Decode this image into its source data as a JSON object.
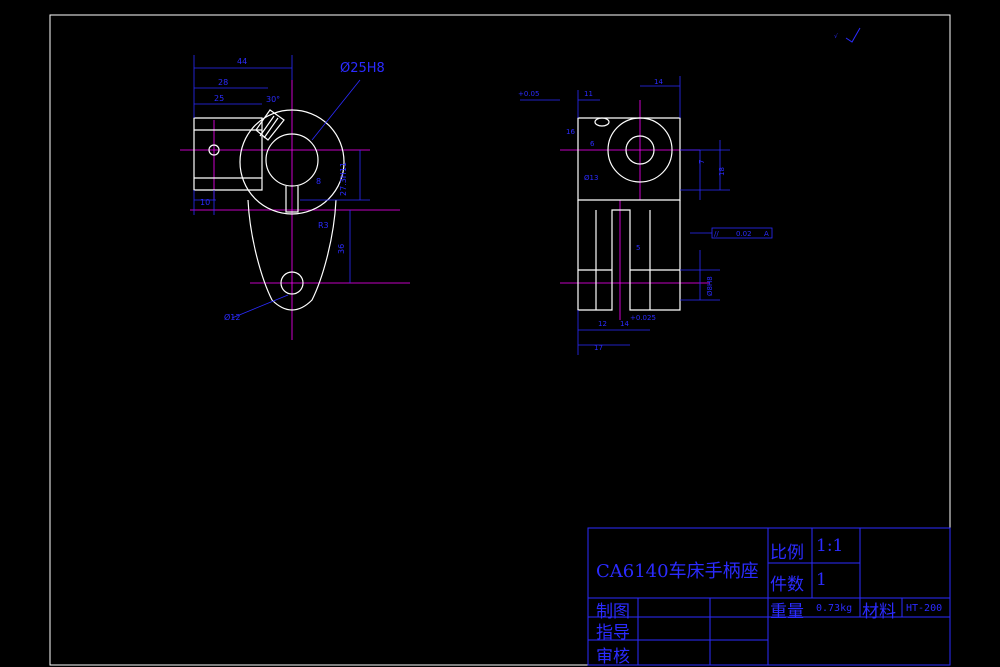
{
  "colors": {
    "background": "#000000",
    "frame": "#ffffff",
    "part_outline": "#ffffff",
    "dimension": "#2b2bff",
    "centerline": "#ff00ff",
    "title_block": "#2b2bff"
  },
  "front_view": {
    "dimensions": {
      "d44": "44",
      "d28": "28",
      "d25": "25",
      "angle30": "30°",
      "bore": "Ø25H8",
      "d10": "10",
      "d27": "27.3H11",
      "d8": "8",
      "dr3": "R3",
      "d36": "36",
      "d12": "Ø12"
    }
  },
  "side_view": {
    "dimensions": {
      "d14": "14",
      "d11": "11",
      "m": "+0.05",
      "d18": "18",
      "d6": "6",
      "d7": "7",
      "d13": "Ø13",
      "ht": "14",
      "d12": "12",
      "d14b": "14",
      "tol": "+0.025",
      "d17": "17",
      "fit": "Ø8H8",
      "d5": "5",
      "d16": "16"
    },
    "tolerance_frame": [
      "//",
      "0.02",
      "A"
    ]
  },
  "roughness_symbol": "√",
  "title_block": {
    "part_name": "CA6140车床手柄座",
    "scale_label": "比例",
    "scale_value": "1:1",
    "qty_label": "件数",
    "qty_value": "1",
    "weight_label": "重量",
    "weight_value": "0.73kg",
    "material_label": "材料",
    "material_value": "HT-200",
    "drawn_label": "制图",
    "guide_label": "指导",
    "check_label": "审核"
  }
}
